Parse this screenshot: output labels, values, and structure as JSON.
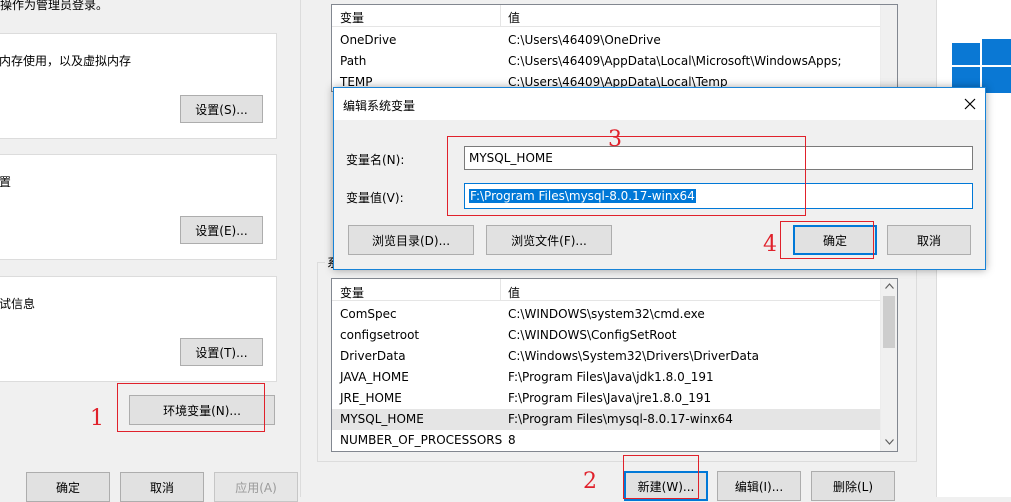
{
  "sys_props": {
    "header_text": "操作为管理员登录。",
    "performance": {
      "desc": "内存使用，以及虚拟内存",
      "button": "设置(S)..."
    },
    "profiles": {
      "desc": "置",
      "button": "设置(E)..."
    },
    "startup": {
      "desc": "试信息",
      "button": "设置(T)..."
    },
    "env_button": "环境变量(N)...",
    "ok": "确定",
    "cancel": "取消",
    "apply": "应用(A)"
  },
  "env_vars": {
    "user_vars": {
      "headers": [
        "变量",
        "值"
      ],
      "rows": [
        {
          "name": "OneDrive",
          "value": "C:\\Users\\46409\\OneDrive"
        },
        {
          "name": "Path",
          "value": "C:\\Users\\46409\\AppData\\Local\\Microsoft\\WindowsApps;"
        },
        {
          "name": "TEMP",
          "value": "C:\\Users\\46409\\AppData\\Local\\Temp"
        }
      ]
    },
    "system_group_label": "系",
    "system_vars": {
      "headers": [
        "变量",
        "值"
      ],
      "rows": [
        {
          "name": "ComSpec",
          "value": "C:\\WINDOWS\\system32\\cmd.exe"
        },
        {
          "name": "configsetroot",
          "value": "C:\\WINDOWS\\ConfigSetRoot"
        },
        {
          "name": "DriverData",
          "value": "C:\\Windows\\System32\\Drivers\\DriverData"
        },
        {
          "name": "JAVA_HOME",
          "value": "F:\\Program Files\\Java\\jdk1.8.0_191"
        },
        {
          "name": "JRE_HOME",
          "value": "F:\\Program Files\\Java\\jre1.8.0_191"
        },
        {
          "name": "MYSQL_HOME",
          "value": "F:\\Program Files\\mysql-8.0.17-winx64",
          "selected": true
        },
        {
          "name": "NUMBER_OF_PROCESSORS",
          "value": "8"
        }
      ]
    },
    "new_button": "新建(W)...",
    "edit_button": "编辑(I)...",
    "delete_button": "删除(L)"
  },
  "edit_dialog": {
    "title": "编辑系统变量",
    "name_label": "变量名(N):",
    "name_value": "MYSQL_HOME",
    "value_label": "变量值(V):",
    "value_value": "F:\\Program Files\\mysql-8.0.17-winx64",
    "browse_dir": "浏览目录(D)...",
    "browse_file": "浏览文件(F)...",
    "ok": "确定",
    "cancel": "取消",
    "close_icon": "close-icon"
  },
  "annotations": [
    "1",
    "2",
    "3",
    "4"
  ],
  "colors": {
    "annotation_red": "#e0212b",
    "selection_blue": "#0078d7",
    "windows_blue": "#0a78d4",
    "dialog_border": "#1883d7"
  }
}
